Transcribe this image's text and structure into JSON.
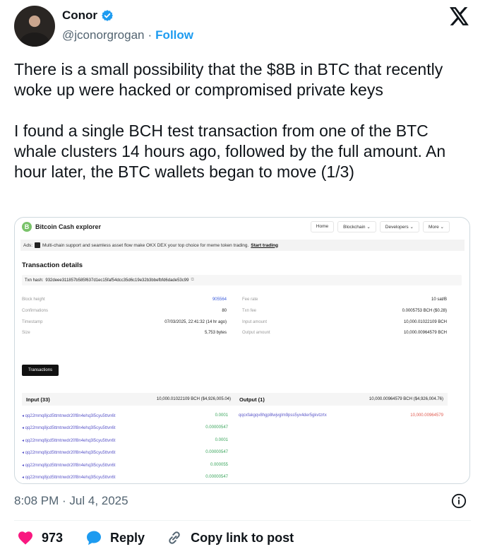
{
  "author": {
    "name": "Conor",
    "handle": "@jconorgrogan",
    "separator": "·",
    "follow_label": "Follow"
  },
  "tweet": {
    "paragraph1": "There is a small possibility that the $8B in BTC that recently woke up were hacked or compromised private keys",
    "paragraph2": "I found a single BCH test transaction from one of the BTC whale clusters 14 hours ago, followed by the full amount. An hour later, the BTC wallets began to move (1/3)"
  },
  "explorer": {
    "title": "Bitcoin Cash explorer",
    "logo_glyph": "B",
    "menu": [
      "Home",
      "Blockchain ⌄",
      "Developers ⌄",
      "More ⌄"
    ],
    "ads_prefix": "Ads:",
    "ads_text": "Multi-chain support and seamless asset flow make OKX DEX your top choice for meme token trading.",
    "ads_cta": "Start trading",
    "heading": "Transaction details",
    "hash_label": "Txn hash:",
    "hash_value": "932deee311857b585f637d1ec15faf54dcc35d6c19e32b3bbefbfd6dade53c99",
    "left_fields": [
      {
        "k": "Block height",
        "v": "905564"
      },
      {
        "k": "Confirmations",
        "v": "80"
      },
      {
        "k": "Timestamp",
        "v": "07/03/2025, 22:41:32 (14 hr ago)"
      },
      {
        "k": "Size",
        "v": "5,753 bytes"
      }
    ],
    "right_fields": [
      {
        "k": "Fee rate",
        "v": "10 sat/B"
      },
      {
        "k": "Txn fee",
        "v": "0.0005753 BCH ($0.28)"
      },
      {
        "k": "Input amount",
        "v": "10,000.01022109 BCH"
      },
      {
        "k": "Output amount",
        "v": "10,000.00964579 BCH"
      }
    ],
    "transactions_button": "Transactions",
    "input_header": {
      "title": "Input (33)",
      "amount": "10,000.01022109 BCH ($4,926,005.04)"
    },
    "output_header": {
      "title": "Output (1)",
      "amount": "10,000.00964579 BCH ($4,926,004.76)"
    },
    "inputs": [
      {
        "addr": "◂ qq22mmq8jcd5ttmtnwdr20f8n4ehq3l5cyu5ttvn6t",
        "amt": "0.0001"
      },
      {
        "addr": "◂ qq22mmq8jcd5ttmtnwdr20f8n4ehq3l5cyu5ttvn6t",
        "amt": "0.00000547"
      },
      {
        "addr": "◂ qq22mmq8jcd5ttmtnwdr20f8n4ehq3l5cyu5ttvn6t",
        "amt": "0.0001"
      },
      {
        "addr": "◂ qq22mmq8jcd5ttmtnwdr20f8n4ehq3l5cyu5ttvn6t",
        "amt": "0.00000547"
      },
      {
        "addr": "◂ qq22mmq8jcd5ttmtnwdr20f8n4ehq3l5cyu5ttvn6t",
        "amt": "0.000055"
      },
      {
        "addr": "◂ qq22mmq8jcd5ttmtnwdr20f8n4ehq3l5cyu5ttvn6t",
        "amt": "0.00000547"
      }
    ],
    "output": {
      "addr": "qqcxfakgqv8hgp8lwjvglm9pss5yx4der5gkvtzrtx",
      "amt": "10,000.00964579"
    }
  },
  "footer": {
    "timestamp": "8:08 PM · Jul 4, 2025",
    "likes": "973",
    "reply_label": "Reply",
    "copy_label": "Copy link to post"
  },
  "colors": {
    "accent": "#1d9bf0",
    "like": "#f91880",
    "muted": "#536471",
    "text": "#0f1419"
  },
  "icons": [
    "verified-badge-icon",
    "x-logo-icon",
    "info-icon",
    "heart-icon",
    "reply-bubble-icon",
    "link-icon"
  ]
}
